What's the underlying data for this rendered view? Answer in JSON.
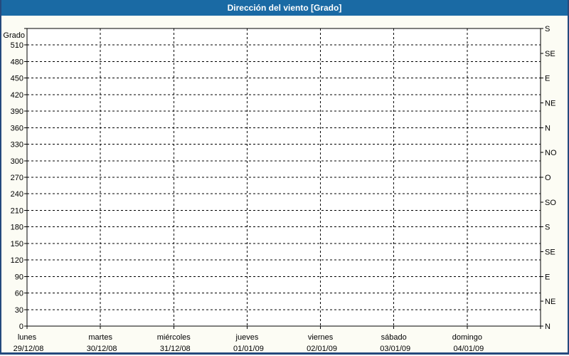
{
  "window": {
    "title": "Dirección del viento [Grado]"
  },
  "colors": {
    "title_bar": "#1a6aa4",
    "title_text": "#ffffff",
    "outer_border": "#254a7d",
    "panel_background": "#fcfcf4",
    "plot_background": "#ffffff",
    "grid_line": "#000000",
    "axis_text": "#000000"
  },
  "chart_data": {
    "type": "line",
    "title": "Dirección del viento [Grado]",
    "ylabel": "Grado",
    "ylim": [
      0,
      540
    ],
    "grid": true,
    "legend": "none",
    "y_left_ticks": [
      0,
      30,
      60,
      90,
      120,
      150,
      180,
      210,
      240,
      270,
      300,
      330,
      360,
      390,
      420,
      450,
      480,
      510
    ],
    "y_right_ticks": [
      {
        "deg": 0,
        "label": "N"
      },
      {
        "deg": 45,
        "label": "NE"
      },
      {
        "deg": 90,
        "label": "E"
      },
      {
        "deg": 135,
        "label": "SE"
      },
      {
        "deg": 180,
        "label": "S"
      },
      {
        "deg": 225,
        "label": "SO"
      },
      {
        "deg": 270,
        "label": "O"
      },
      {
        "deg": 315,
        "label": "NO"
      },
      {
        "deg": 360,
        "label": "N"
      },
      {
        "deg": 405,
        "label": "NE"
      },
      {
        "deg": 450,
        "label": "E"
      },
      {
        "deg": 495,
        "label": "SE"
      },
      {
        "deg": 540,
        "label": "S"
      }
    ],
    "x_days": [
      {
        "name": "lunes",
        "date": "29/12/08"
      },
      {
        "name": "martes",
        "date": "30/12/08"
      },
      {
        "name": "miércoles",
        "date": "31/12/08"
      },
      {
        "name": "jueves",
        "date": "01/01/09"
      },
      {
        "name": "viernes",
        "date": "02/01/09"
      },
      {
        "name": "sábado",
        "date": "03/01/09"
      },
      {
        "name": "domingo",
        "date": "04/01/09"
      }
    ],
    "x_divisions": 7,
    "series": []
  }
}
